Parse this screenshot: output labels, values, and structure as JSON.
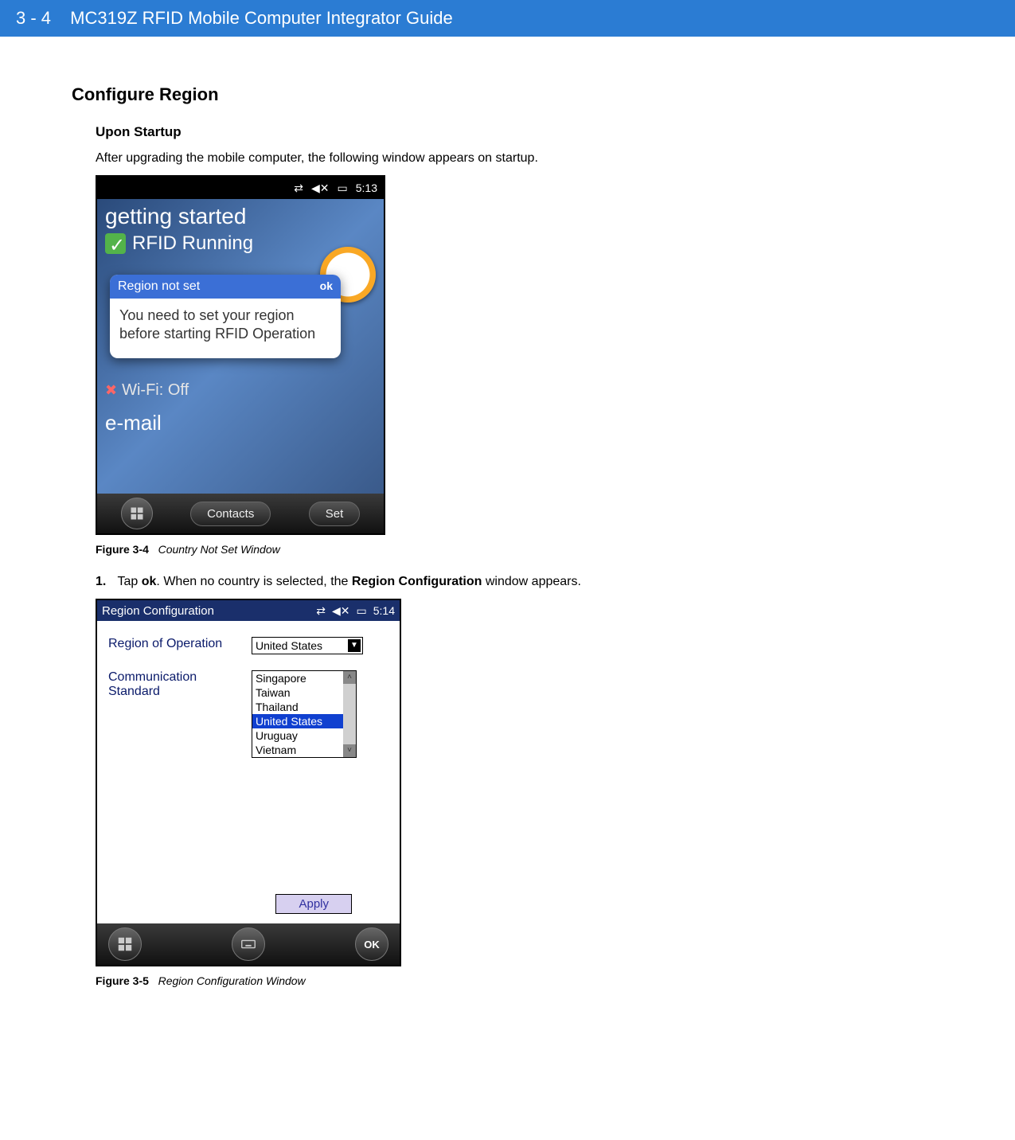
{
  "header": {
    "page_num": "3 - 4",
    "title": "MC319Z RFID Mobile Computer Integrator Guide"
  },
  "section": {
    "title": "Configure Region",
    "sub": "Upon Startup",
    "intro": "After upgrading the mobile computer, the following window appears on startup."
  },
  "fig1": {
    "label": "Figure 3-4",
    "caption": "Country Not Set Window",
    "statusbar_time": "5:13",
    "getting_started": "getting started",
    "rfid_running": "RFID Running",
    "dialog_title": "Region not set",
    "dialog_ok": "ok",
    "dialog_body": "You need to set your region before starting RFID Operation",
    "wifi": "Wi-Fi: Off",
    "email": "e-mail",
    "btn_contacts": "Contacts",
    "btn_set": "Set"
  },
  "step1": {
    "num": "1.",
    "pre": "Tap ",
    "bold1": "ok",
    "mid": ". When no country is selected, the ",
    "bold2": "Region Configuration",
    "post": " window appears."
  },
  "fig2": {
    "label": "Figure 3-5",
    "caption": "Region Configuration Window",
    "window_title": "Region Configuration",
    "statusbar_time": "5:14",
    "label_region": "Region of Operation",
    "label_comm": "Communication Standard",
    "selected": "United States",
    "options": [
      "Singapore",
      "Taiwan",
      "Thailand",
      "United States",
      "Uruguay",
      "Vietnam"
    ],
    "highlighted_index": 3,
    "apply": "Apply",
    "ok": "OK"
  }
}
